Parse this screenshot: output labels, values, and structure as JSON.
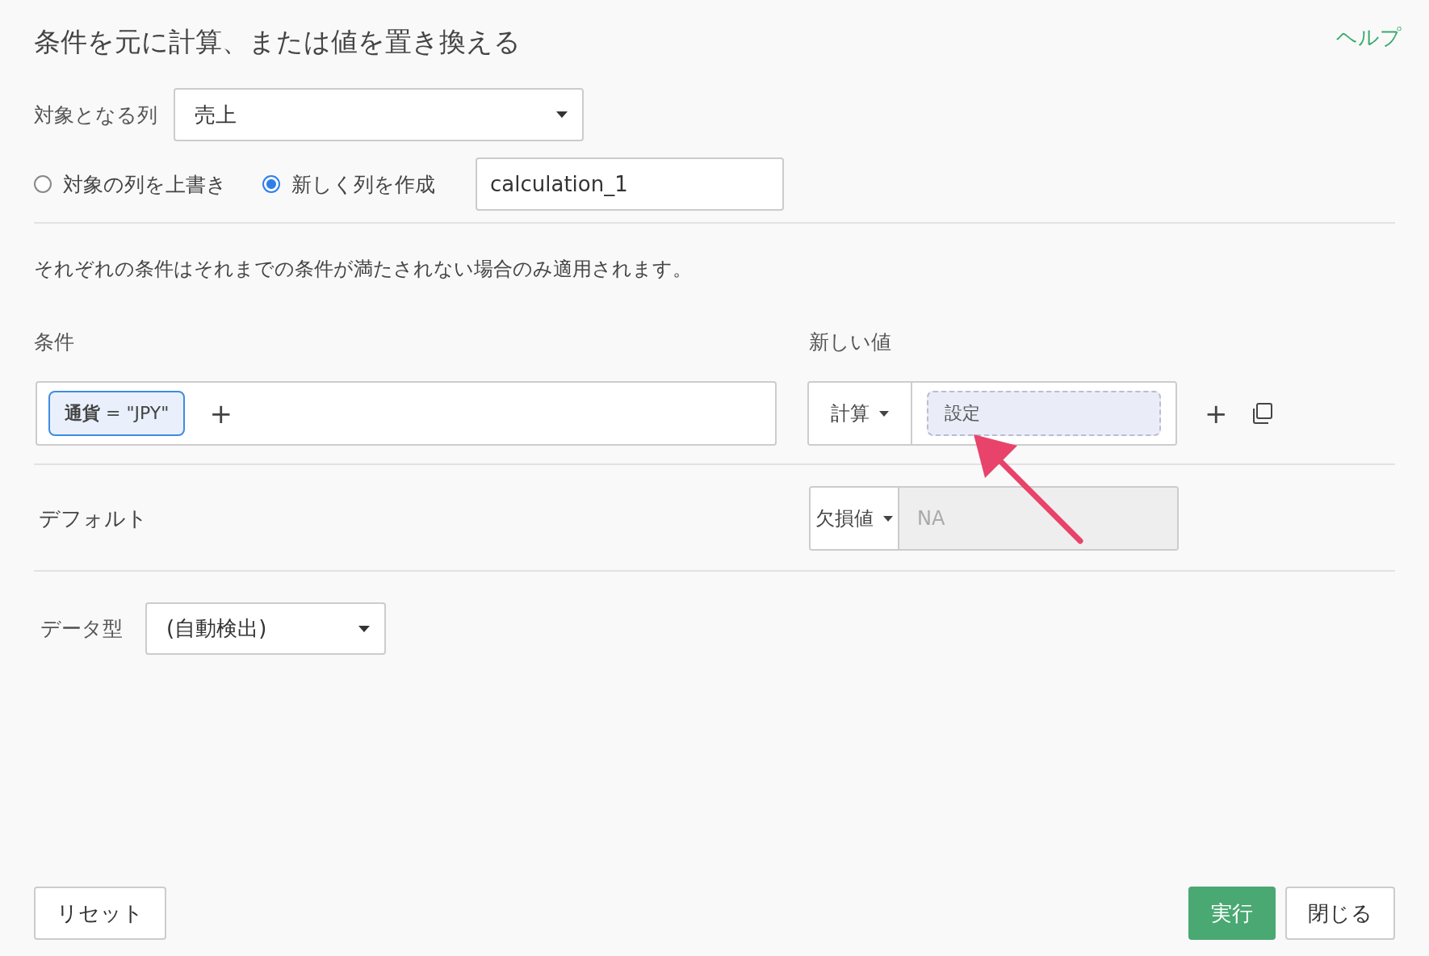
{
  "title": "条件を元に計算、または値を置き換える",
  "help_link": "ヘルプ",
  "target_column": {
    "label": "対象となる列",
    "value": "売上"
  },
  "output_mode": [
    {
      "label": "対象の列を上書き",
      "selected": false
    },
    {
      "label": "新しく列を作成",
      "selected": true
    }
  ],
  "new_column_name": "calculation_1",
  "note": "それぞれの条件はそれまでの条件が満たされない場合のみ適用されます。",
  "condition_header": "条件",
  "value_header": "新しい値",
  "rows": [
    {
      "condition": "**通貨** = \"JPY\"",
      "add_symbol": "+",
      "value_type": "計算",
      "value": "設定",
      "row_add_symbol": "+"
    }
  ],
  "default": {
    "label": "デフォルト",
    "type": "欠損値",
    "placeholder": "NA",
    "disabled": true
  },
  "data_type": {
    "label": "データ型",
    "value": "(自動検出)"
  },
  "footer": {
    "left": [
      {
        "label": "リセット",
        "kind": "secondary"
      }
    ],
    "right": [
      {
        "label": "実行",
        "kind": "primary"
      },
      {
        "label": "閉じる",
        "kind": "secondary"
      }
    ]
  }
}
